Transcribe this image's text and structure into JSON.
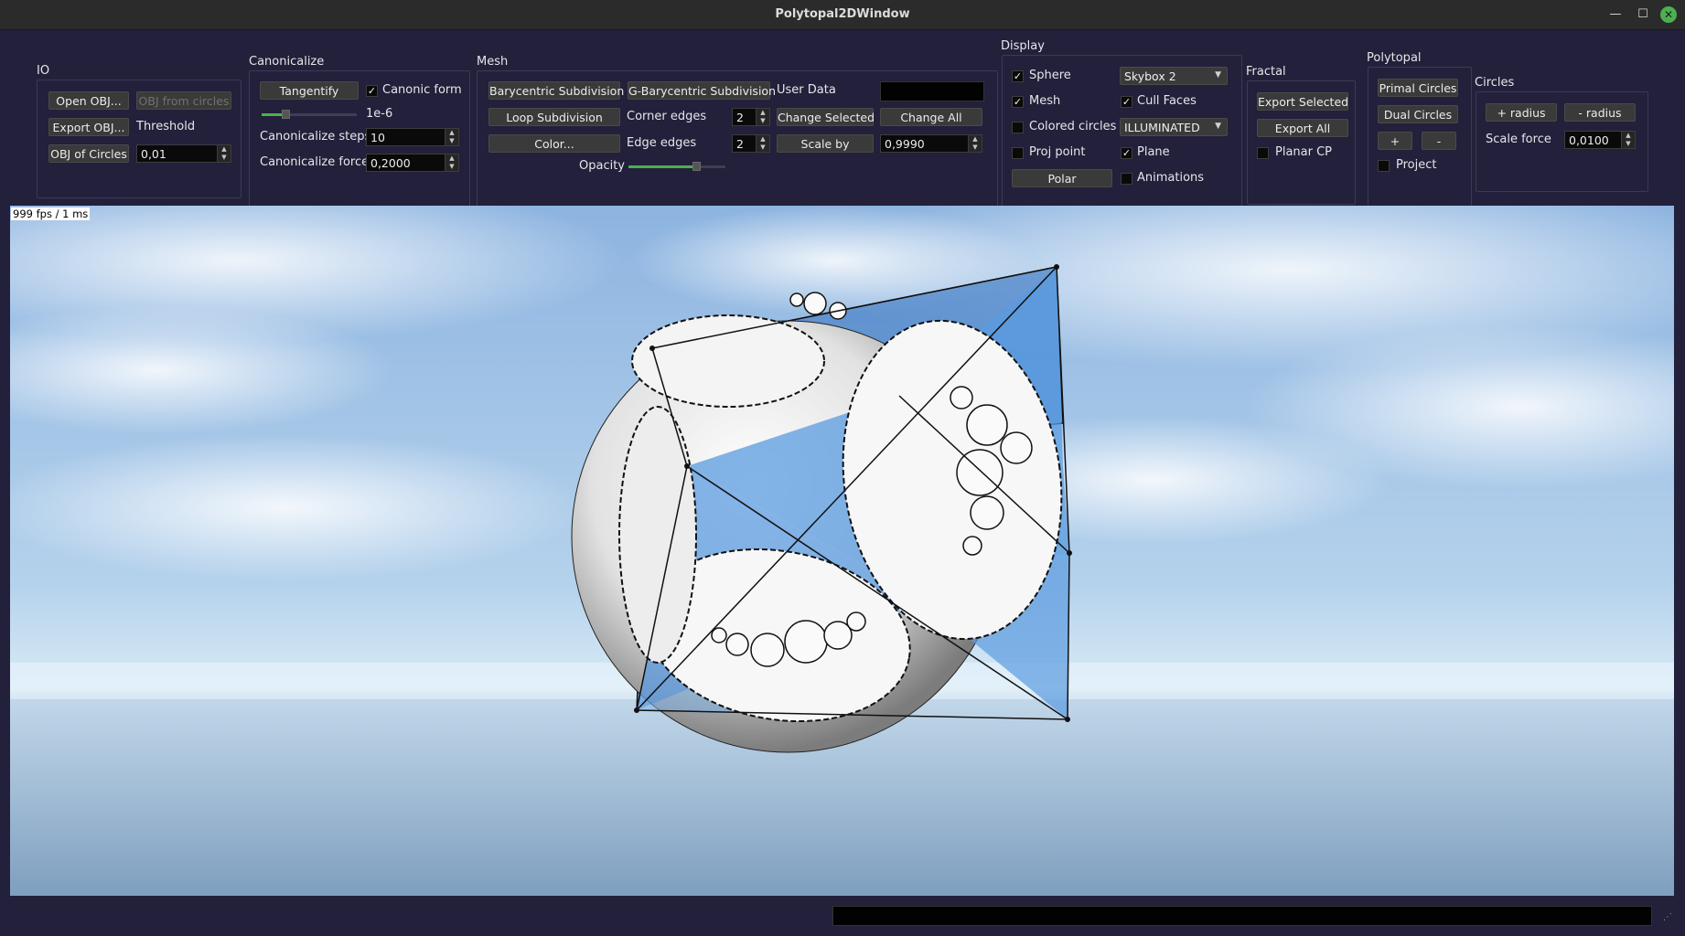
{
  "window": {
    "title": "Polytopal2DWindow",
    "minimize": "—",
    "maximize": "☐",
    "close": "✕"
  },
  "io": {
    "title": "IO",
    "open_obj": "Open OBJ...",
    "obj_from_circles": "OBJ from circles",
    "export_obj": "Export OBJ...",
    "threshold_label": "Threshold",
    "obj_of_circles": "OBJ of Circles",
    "threshold_value": "0,01"
  },
  "canonicalize": {
    "title": "Canonicalize",
    "tangentify": "Tangentify",
    "canonic_form_label": "Canonic form",
    "canonic_form_checked": true,
    "tolerance_label": "1e-6",
    "tolerance_level": 0.25,
    "steps_label": "Canonicalize steps",
    "steps_value": "10",
    "force_label": "Canonicalize force",
    "force_value": "0,2000"
  },
  "mesh": {
    "title": "Mesh",
    "barycentric": "Barycentric Subdivision",
    "g_barycentric": "G-Barycentric Subdivision",
    "user_data_label": "User Data",
    "loop_subdivision": "Loop Subdivision",
    "corner_edges_label": "Corner edges",
    "corner_edges_value": "2",
    "change_selected": "Change Selected",
    "change_all": "Change All",
    "color": "Color...",
    "edge_edges_label": "Edge edges",
    "edge_edges_value": "2",
    "scale_by": "Scale by",
    "scale_value": "0,9990",
    "opacity_label": "Opacity",
    "opacity_level": 0.7
  },
  "display": {
    "title": "Display",
    "sphere_label": "Sphere",
    "sphere_checked": true,
    "skybox_value": "Skybox 2",
    "mesh_label": "Mesh",
    "mesh_checked": true,
    "cull_faces_label": "Cull Faces",
    "cull_faces_checked": true,
    "colored_circles_label": "Colored circles",
    "colored_circles_checked": false,
    "shading_value": "ILLUMINATED",
    "proj_point_label": "Proj point",
    "proj_point_checked": false,
    "plane_label": "Plane",
    "plane_checked": true,
    "polar": "Polar",
    "animations_label": "Animations",
    "animations_checked": false
  },
  "fractal": {
    "title": "Fractal",
    "export_selected": "Export Selected",
    "export_all": "Export All",
    "planar_cp_label": "Planar CP",
    "planar_cp_checked": false
  },
  "polytopal": {
    "title": "Polytopal",
    "primal_circles": "Primal Circles",
    "dual_circles": "Dual Circles",
    "plus": "+",
    "minus": "-",
    "project_label": "Project",
    "project_checked": false
  },
  "circles": {
    "title": "Circles",
    "plus_radius": "+ radius",
    "minus_radius": "- radius",
    "scale_force_label": "Scale force",
    "scale_force_value": "0,0100"
  },
  "viewport": {
    "fps_text": "999 fps / 1 ms"
  },
  "colors": {
    "accent": "#4caf50",
    "background": "#22203a",
    "sky": "#8fb6e0",
    "polytope": "#5b9be0"
  }
}
